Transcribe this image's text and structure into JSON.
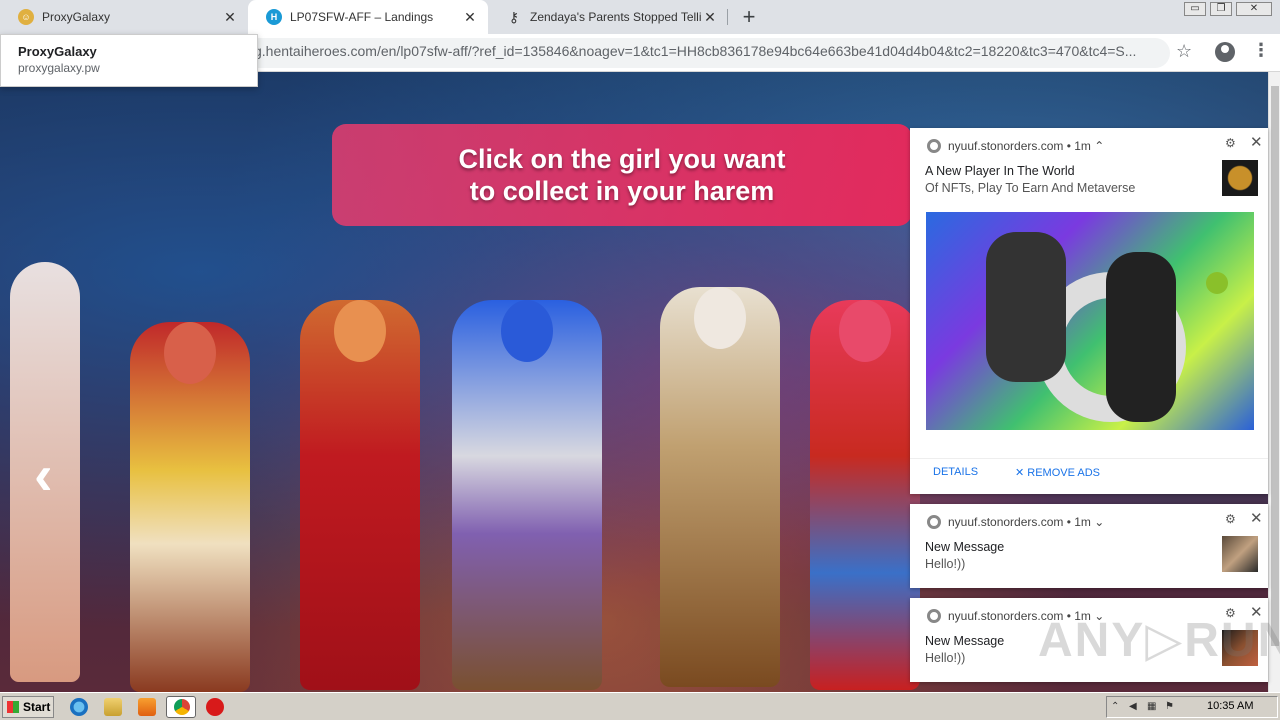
{
  "tabs": [
    {
      "title": "ProxyGalaxy",
      "favicon": "proxygalaxy-icon",
      "active": false
    },
    {
      "title": "LP07SFW-AFF – Landings",
      "favicon": "landings-icon",
      "active": true
    },
    {
      "title": "Zendaya's Parents Stopped Telling H",
      "favicon": "key-icon",
      "active": false
    }
  ],
  "new_tab_label": "+",
  "window": {
    "minimize": "▭",
    "restore": "❐",
    "close": "✕"
  },
  "address": {
    "url": "g.hentaiheroes.com/en/lp07sfw-aff/?ref_id=135846&noagev=1&tc1=HH8cb836178e94bc64e663be41d04d4b04&tc2=18220&tc3=470&tc4=S..."
  },
  "hovercard": {
    "title": "ProxyGalaxy",
    "domain": "proxygalaxy.pw"
  },
  "page": {
    "banner_line1": "Click on the girl you want",
    "banner_line2": "to collect in your harem",
    "prev_arrow": "‹"
  },
  "notifications": [
    {
      "source": "nyuuf.stonorders.com  •  1m ⌃",
      "title": "A New Player In The World",
      "message": "Of NFTs, Play To Earn And Metaverse",
      "details_label": "DETAILS",
      "remove_label": "✕ REMOVE ADS"
    },
    {
      "source": "nyuuf.stonorders.com  •  1m ⌄",
      "title": "New Message",
      "message": "Hello!))"
    },
    {
      "source": "nyuuf.stonorders.com  •  1m ⌄",
      "title": "New Message",
      "message": "Hello!))"
    }
  ],
  "watermark": "ANY▷RUN",
  "taskbar": {
    "start_label": "Start",
    "clock": "10:35 AM"
  },
  "colors": {
    "banner": "#e8365f",
    "link": "#1a73e8",
    "taskbar": "#d4d0c8"
  }
}
